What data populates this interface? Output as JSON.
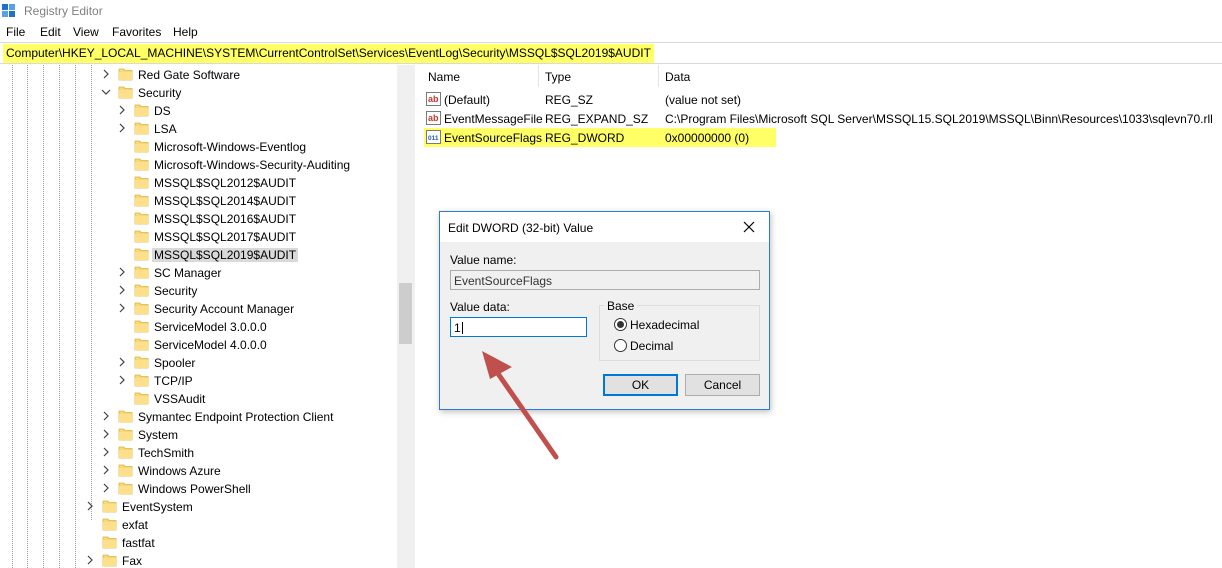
{
  "window": {
    "title": "Registry Editor"
  },
  "menu": [
    "File",
    "Edit",
    "View",
    "Favorites",
    "Help"
  ],
  "address": "Computer\\HKEY_LOCAL_MACHINE\\SYSTEM\\CurrentControlSet\\Services\\EventLog\\Security\\MSSQL$SQL2019$AUDIT",
  "tree": [
    {
      "label": "Red Gate Software",
      "expander": "collapsed"
    },
    {
      "label": "Security",
      "expander": "expanded"
    },
    {
      "label": "DS",
      "expander": "collapsed"
    },
    {
      "label": "LSA",
      "expander": "collapsed"
    },
    {
      "label": "Microsoft-Windows-Eventlog",
      "expander": "none"
    },
    {
      "label": "Microsoft-Windows-Security-Auditing",
      "expander": "none"
    },
    {
      "label": "MSSQL$SQL2012$AUDIT",
      "expander": "none"
    },
    {
      "label": "MSSQL$SQL2014$AUDIT",
      "expander": "none"
    },
    {
      "label": "MSSQL$SQL2016$AUDIT",
      "expander": "none"
    },
    {
      "label": "MSSQL$SQL2017$AUDIT",
      "expander": "none"
    },
    {
      "label": "MSSQL$SQL2019$AUDIT",
      "expander": "none",
      "selected": true
    },
    {
      "label": "SC Manager",
      "expander": "collapsed"
    },
    {
      "label": "Security",
      "expander": "collapsed"
    },
    {
      "label": "Security Account Manager",
      "expander": "collapsed"
    },
    {
      "label": "ServiceModel 3.0.0.0",
      "expander": "none"
    },
    {
      "label": "ServiceModel 4.0.0.0",
      "expander": "none"
    },
    {
      "label": "Spooler",
      "expander": "collapsed"
    },
    {
      "label": "TCP/IP",
      "expander": "collapsed"
    },
    {
      "label": "VSSAudit",
      "expander": "none"
    },
    {
      "label": "Symantec Endpoint Protection Client",
      "expander": "collapsed"
    },
    {
      "label": "System",
      "expander": "collapsed"
    },
    {
      "label": "TechSmith",
      "expander": "collapsed"
    },
    {
      "label": "Windows Azure",
      "expander": "collapsed"
    },
    {
      "label": "Windows PowerShell",
      "expander": "collapsed"
    },
    {
      "label": "EventSystem",
      "expander": "collapsed"
    },
    {
      "label": "exfat",
      "expander": "none"
    },
    {
      "label": "fastfat",
      "expander": "none"
    },
    {
      "label": "Fax",
      "expander": "collapsed"
    }
  ],
  "columns": {
    "name": "Name",
    "type": "Type",
    "data": "Data"
  },
  "values": [
    {
      "name": "(Default)",
      "type": "REG_SZ",
      "data": "(value not set)",
      "icon": "string-value-icon"
    },
    {
      "name": "EventMessageFile",
      "type": "REG_EXPAND_SZ",
      "data": "C:\\Program Files\\Microsoft SQL Server\\MSSQL15.SQL2019\\MSSQL\\Binn\\Resources\\1033\\sqlevn70.rll",
      "icon": "string-value-icon"
    },
    {
      "name": "EventSourceFlags",
      "type": "REG_DWORD",
      "data": "0x00000000 (0)",
      "icon": "binary-value-icon",
      "highlighted": true
    }
  ],
  "dialog": {
    "title": "Edit DWORD (32-bit) Value",
    "value_name_label": "Value name:",
    "value_name": "EventSourceFlags",
    "value_data_label": "Value data:",
    "value_data": "1",
    "base_label": "Base",
    "base_options": [
      "Hexadecimal",
      "Decimal"
    ],
    "base_selected": "Hexadecimal",
    "ok_label": "OK",
    "cancel_label": "Cancel"
  },
  "colors": {
    "highlight": "#ffff66",
    "annotation_arrow": "#c0504d",
    "dialog_border": "#2b79d9"
  }
}
